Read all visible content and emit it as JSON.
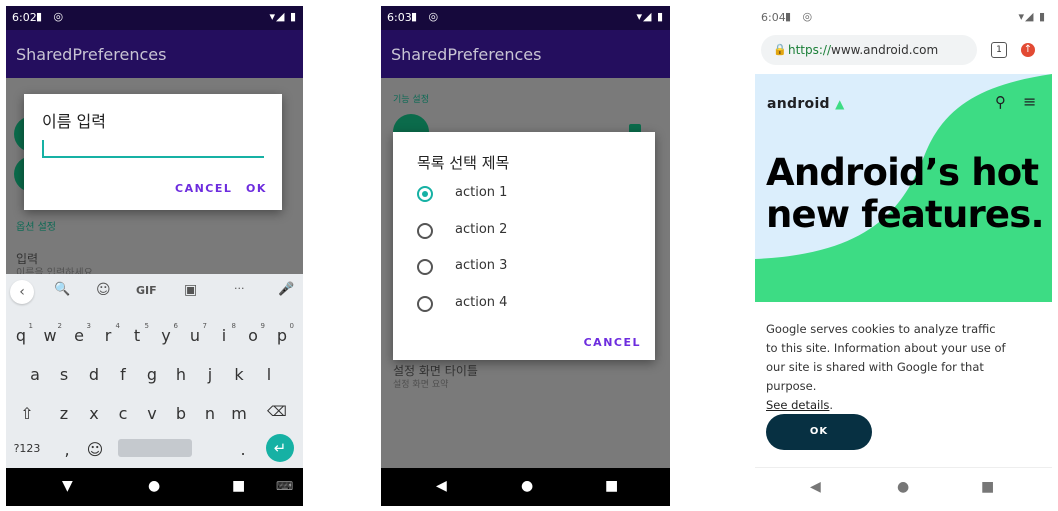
{
  "screen1": {
    "status": {
      "time": "6:02",
      "icons": "▮ ◎",
      "right": "▾◢ ▮"
    },
    "app_title": "SharedPreferences",
    "bg_section": "옵션 설정",
    "bg_item_title": "입력",
    "bg_item_summary": "이름을 입력하세요",
    "dialog": {
      "title": "이름 입력",
      "input_value": "",
      "cancel": "CANCEL",
      "ok": "OK"
    },
    "keyboard": {
      "toolbar": [
        "‹",
        "🔍",
        "☺",
        "GIF",
        "▣",
        "···",
        "🎤"
      ],
      "row1": [
        [
          "q",
          "1"
        ],
        [
          "w",
          "2"
        ],
        [
          "e",
          "3"
        ],
        [
          "r",
          "4"
        ],
        [
          "t",
          "5"
        ],
        [
          "y",
          "6"
        ],
        [
          "u",
          "7"
        ],
        [
          "i",
          "8"
        ],
        [
          "o",
          "9"
        ],
        [
          "p",
          "0"
        ]
      ],
      "row2": [
        "a",
        "s",
        "d",
        "f",
        "g",
        "h",
        "j",
        "k",
        "l"
      ],
      "row3": [
        "⇧",
        "z",
        "x",
        "c",
        "v",
        "b",
        "n",
        "m",
        "⌫"
      ],
      "row4": {
        "sym": "?123",
        "comma": ",",
        "emoji": "☺",
        "period": ".",
        "enter": "↵"
      }
    },
    "nav": {
      "back": "▼",
      "home": "●",
      "recent": "■",
      "kb": "⌨"
    }
  },
  "screen2": {
    "status": {
      "time": "6:03",
      "icons": "▮ ◎",
      "right": "▾◢ ▮"
    },
    "app_title": "SharedPreferences",
    "bg_section": "기능 설정",
    "bg_item_title": "설정 화면 타이틀",
    "bg_item_summary": "설정 화면 요약",
    "dialog": {
      "title": "목록 선택 제목",
      "options": [
        "action 1",
        "action 2",
        "action 3",
        "action 4"
      ],
      "selected": 0,
      "cancel": "CANCEL"
    },
    "nav": {
      "back": "◀",
      "home": "●",
      "recent": "■"
    }
  },
  "screen3": {
    "status": {
      "time": "6:04",
      "icons": "▮ ◎",
      "right": "▾◢ ▮"
    },
    "url_scheme": "https://",
    "url_host": "www.android.com",
    "tab_count": "1",
    "logo": "android",
    "headline": "Android’s hot new features.",
    "cookie_text": "Google serves cookies to analyze traffic to this site. Information about your use of our site is shared with Google for that purpose.",
    "cookie_link": "See details",
    "ok": "OK",
    "colors": {
      "accent_green": "#3ddc84",
      "hero_blue": "#dbeefc",
      "ok_bg": "#073042"
    },
    "nav": {
      "back": "◀",
      "home": "●",
      "recent": "■"
    }
  }
}
